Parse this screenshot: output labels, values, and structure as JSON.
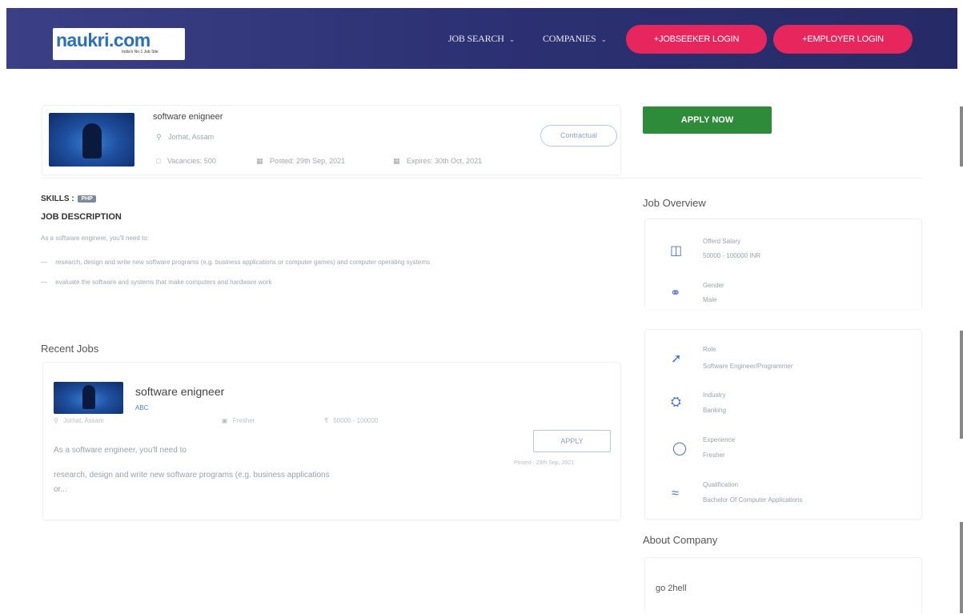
{
  "header": {
    "logo_text": "naukri.com",
    "logo_tagline": "India's No.1 Job Site",
    "nav": [
      {
        "label": "JOB SEARCH"
      },
      {
        "label": "COMPANIES"
      }
    ],
    "jobseeker_login": "+JOBSEEKER LOGIN",
    "employer_login": "+EMPLOYER LOGIN"
  },
  "job": {
    "title": "software enigneer",
    "location": "Jorhat, Assam",
    "type_button": "Contractual",
    "vacancies": "Vacancies: 500",
    "posted": "Posted: 29th Sep, 2021",
    "expires": "Expires: 30th Oct, 2021"
  },
  "apply_now": "APPLY NOW",
  "skills_label": "SKILLS :",
  "skills": [
    "PHP"
  ],
  "description": {
    "heading": "JOB DESCRIPTION",
    "intro": "As a software engineer, you'll need to:",
    "bullets": [
      "research, design and write new software programs (e.g. business applications or computer games) and computer operating systems",
      "evaluate the software and systems that make computers and hardware work"
    ]
  },
  "recent_jobs": {
    "heading": "Recent Jobs",
    "items": [
      {
        "title": "software enigneer",
        "company": "ABC",
        "location": "Jorhat, Assam",
        "experience": "Fresher",
        "salary": "50000 - 100000",
        "apply": "APPLY",
        "posted": "Posted : 29th Sep, 2021",
        "snippet1": "As a software engineer, you'll need to",
        "snippet2": "research, design and write new software programs (e.g. business applications",
        "snippet3": "or..."
      }
    ]
  },
  "overview": {
    "heading": "Job Overview",
    "items": [
      {
        "icon": "money-icon",
        "label": "Offerd Salary",
        "value": "50000 - 100000 INR"
      },
      {
        "icon": "gender-icon",
        "label": "Gender",
        "value": "Male"
      },
      {
        "icon": "pin-icon",
        "label": "Role",
        "value": "Software Engineer/Programmer"
      },
      {
        "icon": "industry-icon",
        "label": "Industry",
        "value": "Banking"
      },
      {
        "icon": "shield-icon",
        "label": "Experience",
        "value": "Fresher"
      },
      {
        "icon": "qualification-icon",
        "label": "Qualification",
        "value": "Bachelor Of Computer Applications"
      }
    ]
  },
  "about_company": {
    "heading": "About Company",
    "text": "go 2hell"
  },
  "colors": {
    "header_bg": "#2c3173",
    "pill": "#e8265e",
    "apply_now": "#2e8b39",
    "accent_blue": "#4a6fd6"
  }
}
